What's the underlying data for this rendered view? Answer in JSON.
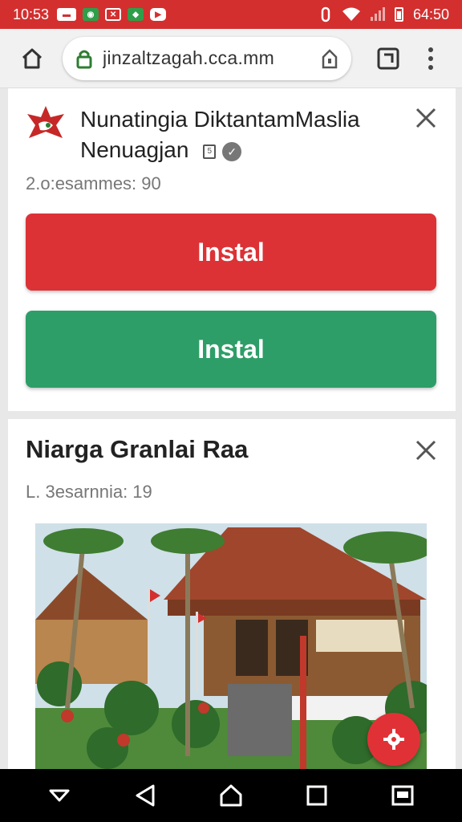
{
  "status": {
    "time": "10:53",
    "clock_right": "64:50",
    "notification_icons": [
      "news-icon",
      "green-app-icon",
      "x-app-icon",
      "android-icon",
      "youtube-icon"
    ]
  },
  "browser": {
    "url": "jinzaltzagah.cca.mm"
  },
  "card1": {
    "title": "Nunatingia DiktantamMaslia Nenuagjan",
    "meta": "2.o:esammes: 90",
    "install_red_label": "Instal",
    "install_green_label": "Instal"
  },
  "card2": {
    "title": "Niarga Granlai Raa",
    "meta": "L. 3esarnnia: 19"
  },
  "colors": {
    "status_bar": "#d32f2f",
    "install_red": "#dc3236",
    "install_green": "#2e9e68",
    "fab": "#e03236"
  }
}
